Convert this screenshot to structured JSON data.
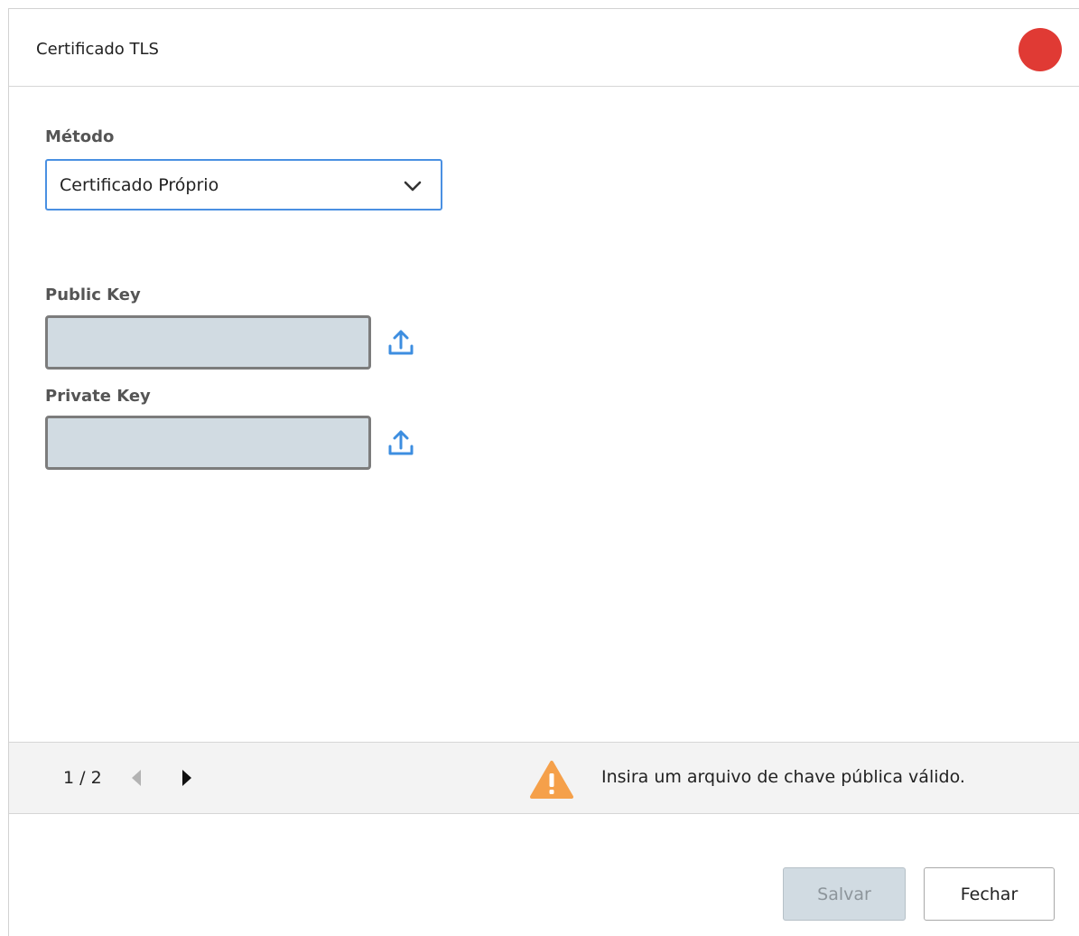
{
  "dialog": {
    "title": "Certificado TLS",
    "status_color": "#e03a34"
  },
  "method": {
    "label": "Método",
    "selected": "Certificado Próprio"
  },
  "public_key": {
    "label": "Public Key",
    "value": ""
  },
  "private_key": {
    "label": "Private Key",
    "value": ""
  },
  "footer": {
    "page": "1 / 2",
    "prev_icon": "triangle-left-icon",
    "next_icon": "triangle-right-icon",
    "warning_icon": "warning-triangle-icon",
    "warning_text": "Insira um arquivo de chave pública válido."
  },
  "actions": {
    "save_label": "Salvar",
    "close_label": "Fechar"
  },
  "colors": {
    "accent": "#4a90e2",
    "warning": "#f5a04a",
    "status": "#e03a34"
  }
}
